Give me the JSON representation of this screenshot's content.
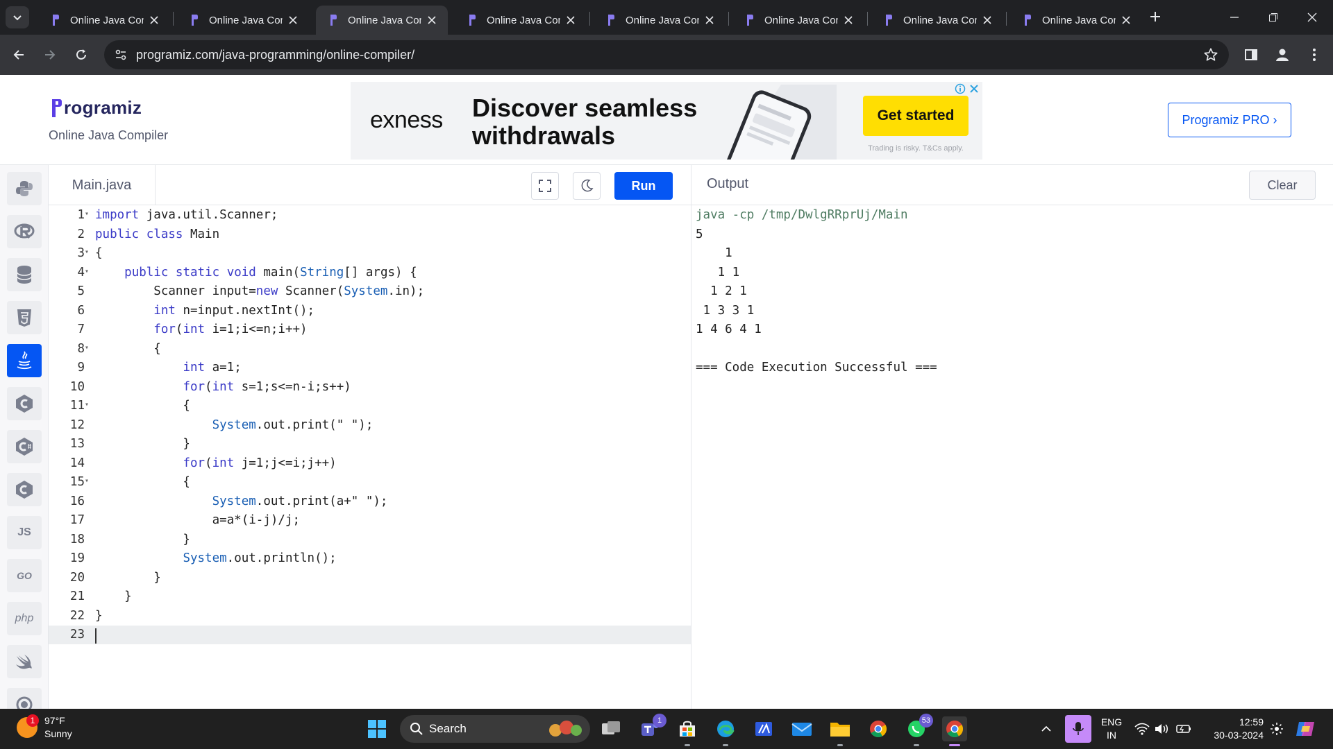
{
  "browser": {
    "tabs": [
      {
        "label": "Online Java Com",
        "active": false
      },
      {
        "label": "Online Java Com",
        "active": false
      },
      {
        "label": "Online Java Com",
        "active": true
      },
      {
        "label": "Online Java Com",
        "active": false
      },
      {
        "label": "Online Java Com",
        "active": false
      },
      {
        "label": "Online Java Com",
        "active": false
      },
      {
        "label": "Online Java Com",
        "active": false
      },
      {
        "label": "Online Java Com",
        "active": false
      }
    ],
    "url": "programiz.com/java-programming/online-compiler/"
  },
  "header": {
    "logo_text": "rogramiz",
    "subtitle": "Online Java Compiler",
    "pro_button": "Programiz PRO ›"
  },
  "ad": {
    "brand": "exness",
    "headline": "Discover seamless withdrawals",
    "cta": "Get started",
    "disclaimer": "Trading is risky. T&Cs apply."
  },
  "sidebar": {
    "languages": [
      "python",
      "r",
      "sql",
      "html",
      "java",
      "c",
      "csharp",
      "cpp",
      "JS",
      "GO",
      "php",
      "swift",
      "rust"
    ],
    "active_language": "java"
  },
  "editor": {
    "file_name": "Main.java",
    "run_label": "Run",
    "lines": [
      "import java.util.Scanner;",
      "public class Main",
      "{",
      "    public static void main(String[] args) {",
      "        Scanner input=new Scanner(System.in);",
      "        int n=input.nextInt();",
      "        for(int i=1;i<=n;i++)",
      "        {",
      "            int a=1;",
      "            for(int s=1;s<=n-i;s++)",
      "            {",
      "                System.out.print(\" \");",
      "            }",
      "            for(int j=1;j<=i;j++)",
      "            {",
      "                System.out.print(a+\" \");",
      "                a=a*(i-j)/j;",
      "            }",
      "            System.out.println();",
      "        }",
      "    }",
      "}",
      ""
    ],
    "fold_lines": [
      1,
      3,
      4,
      8,
      11,
      15
    ],
    "active_line": 23
  },
  "output": {
    "title": "Output",
    "clear_label": "Clear",
    "lines": [
      "java -cp /tmp/DwlgRRprUj/Main",
      "5",
      "    1 ",
      "   1 1 ",
      "  1 2 1 ",
      " 1 3 3 1 ",
      "1 4 6 4 1 ",
      "",
      "=== Code Execution Successful ==="
    ]
  },
  "taskbar": {
    "weather_badge": "1",
    "temperature": "97°F",
    "condition": "Sunny",
    "search_label": "Search",
    "teams_badge": "1",
    "whatsapp_badge": "53",
    "lang_line1": "ENG",
    "lang_line2": "IN",
    "time": "12:59",
    "date": "30-03-2024"
  },
  "colors": {
    "brand_blue": "#0556f3",
    "ad_yellow": "#ffde02",
    "chrome_dark": "#202124"
  }
}
